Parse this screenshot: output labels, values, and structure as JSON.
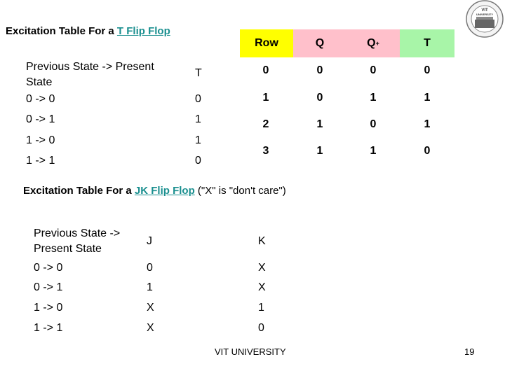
{
  "t_section": {
    "title_prefix": "Excitation Table For a ",
    "title_link": "T Flip Flop",
    "header": {
      "state": "Previous State -> Present State",
      "state_line1": "Previous State -> Present",
      "state_line2": "State",
      "t": "T"
    },
    "rows": [
      {
        "state": "0 -> 0",
        "t": "0"
      },
      {
        "state": "0 -> 1",
        "t": "1"
      },
      {
        "state": "1 -> 0",
        "t": "1"
      },
      {
        "state": "1 -> 1",
        "t": "0"
      }
    ]
  },
  "truth_table": {
    "headers": {
      "row": "Row",
      "q": "Q",
      "q_plus": "Q",
      "q_plus_sup": "+",
      "t": "T"
    },
    "header_colors": {
      "row": "#ffff00",
      "q": "#ffc0cb",
      "q_plus": "#ffc0cb",
      "t": "#a8f5a8"
    },
    "rows": [
      {
        "row": "0",
        "q": "0",
        "q_plus": "0",
        "t": "0"
      },
      {
        "row": "1",
        "q": "0",
        "q_plus": "1",
        "t": "1"
      },
      {
        "row": "2",
        "q": "1",
        "q_plus": "0",
        "t": "1"
      },
      {
        "row": "3",
        "q": "1",
        "q_plus": "1",
        "t": "0"
      }
    ]
  },
  "jk_section": {
    "title_prefix": "Excitation Table For a ",
    "title_link": "JK Flip Flop",
    "title_suffix": " (\"X\" is \"don't care\")",
    "header": {
      "state_line1": "Previous State ->",
      "state_line2": "Present State",
      "j": "J",
      "k": "K"
    },
    "rows": [
      {
        "state": "0 -> 0",
        "j": "0",
        "k": "X"
      },
      {
        "state": "0 -> 1",
        "j": "1",
        "k": "X"
      },
      {
        "state": "1 -> 0",
        "j": "X",
        "k": "1"
      },
      {
        "state": "1 -> 1",
        "j": "X",
        "k": "0"
      }
    ]
  },
  "logo": {
    "icon": "vit-university-seal-icon",
    "text": "VIT UNIVERSITY"
  },
  "footer": {
    "text": "VIT UNIVERSITY",
    "page_number": "19"
  }
}
